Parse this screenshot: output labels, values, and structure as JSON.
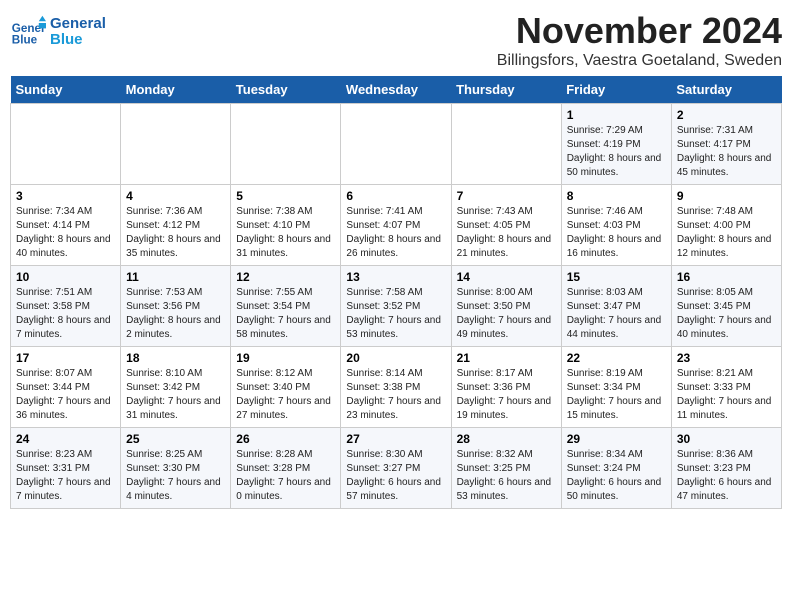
{
  "logo": {
    "text_general": "General",
    "text_blue": "Blue"
  },
  "title": "November 2024",
  "subtitle": "Billingsfors, Vaestra Goetaland, Sweden",
  "weekdays": [
    "Sunday",
    "Monday",
    "Tuesday",
    "Wednesday",
    "Thursday",
    "Friday",
    "Saturday"
  ],
  "weeks": [
    [
      {
        "day": "",
        "detail": ""
      },
      {
        "day": "",
        "detail": ""
      },
      {
        "day": "",
        "detail": ""
      },
      {
        "day": "",
        "detail": ""
      },
      {
        "day": "",
        "detail": ""
      },
      {
        "day": "1",
        "detail": "Sunrise: 7:29 AM\nSunset: 4:19 PM\nDaylight: 8 hours\nand 50 minutes."
      },
      {
        "day": "2",
        "detail": "Sunrise: 7:31 AM\nSunset: 4:17 PM\nDaylight: 8 hours\nand 45 minutes."
      }
    ],
    [
      {
        "day": "3",
        "detail": "Sunrise: 7:34 AM\nSunset: 4:14 PM\nDaylight: 8 hours\nand 40 minutes."
      },
      {
        "day": "4",
        "detail": "Sunrise: 7:36 AM\nSunset: 4:12 PM\nDaylight: 8 hours\nand 35 minutes."
      },
      {
        "day": "5",
        "detail": "Sunrise: 7:38 AM\nSunset: 4:10 PM\nDaylight: 8 hours\nand 31 minutes."
      },
      {
        "day": "6",
        "detail": "Sunrise: 7:41 AM\nSunset: 4:07 PM\nDaylight: 8 hours\nand 26 minutes."
      },
      {
        "day": "7",
        "detail": "Sunrise: 7:43 AM\nSunset: 4:05 PM\nDaylight: 8 hours\nand 21 minutes."
      },
      {
        "day": "8",
        "detail": "Sunrise: 7:46 AM\nSunset: 4:03 PM\nDaylight: 8 hours\nand 16 minutes."
      },
      {
        "day": "9",
        "detail": "Sunrise: 7:48 AM\nSunset: 4:00 PM\nDaylight: 8 hours\nand 12 minutes."
      }
    ],
    [
      {
        "day": "10",
        "detail": "Sunrise: 7:51 AM\nSunset: 3:58 PM\nDaylight: 8 hours\nand 7 minutes."
      },
      {
        "day": "11",
        "detail": "Sunrise: 7:53 AM\nSunset: 3:56 PM\nDaylight: 8 hours\nand 2 minutes."
      },
      {
        "day": "12",
        "detail": "Sunrise: 7:55 AM\nSunset: 3:54 PM\nDaylight: 7 hours\nand 58 minutes."
      },
      {
        "day": "13",
        "detail": "Sunrise: 7:58 AM\nSunset: 3:52 PM\nDaylight: 7 hours\nand 53 minutes."
      },
      {
        "day": "14",
        "detail": "Sunrise: 8:00 AM\nSunset: 3:50 PM\nDaylight: 7 hours\nand 49 minutes."
      },
      {
        "day": "15",
        "detail": "Sunrise: 8:03 AM\nSunset: 3:47 PM\nDaylight: 7 hours\nand 44 minutes."
      },
      {
        "day": "16",
        "detail": "Sunrise: 8:05 AM\nSunset: 3:45 PM\nDaylight: 7 hours\nand 40 minutes."
      }
    ],
    [
      {
        "day": "17",
        "detail": "Sunrise: 8:07 AM\nSunset: 3:44 PM\nDaylight: 7 hours\nand 36 minutes."
      },
      {
        "day": "18",
        "detail": "Sunrise: 8:10 AM\nSunset: 3:42 PM\nDaylight: 7 hours\nand 31 minutes."
      },
      {
        "day": "19",
        "detail": "Sunrise: 8:12 AM\nSunset: 3:40 PM\nDaylight: 7 hours\nand 27 minutes."
      },
      {
        "day": "20",
        "detail": "Sunrise: 8:14 AM\nSunset: 3:38 PM\nDaylight: 7 hours\nand 23 minutes."
      },
      {
        "day": "21",
        "detail": "Sunrise: 8:17 AM\nSunset: 3:36 PM\nDaylight: 7 hours\nand 19 minutes."
      },
      {
        "day": "22",
        "detail": "Sunrise: 8:19 AM\nSunset: 3:34 PM\nDaylight: 7 hours\nand 15 minutes."
      },
      {
        "day": "23",
        "detail": "Sunrise: 8:21 AM\nSunset: 3:33 PM\nDaylight: 7 hours\nand 11 minutes."
      }
    ],
    [
      {
        "day": "24",
        "detail": "Sunrise: 8:23 AM\nSunset: 3:31 PM\nDaylight: 7 hours\nand 7 minutes."
      },
      {
        "day": "25",
        "detail": "Sunrise: 8:25 AM\nSunset: 3:30 PM\nDaylight: 7 hours\nand 4 minutes."
      },
      {
        "day": "26",
        "detail": "Sunrise: 8:28 AM\nSunset: 3:28 PM\nDaylight: 7 hours\nand 0 minutes."
      },
      {
        "day": "27",
        "detail": "Sunrise: 8:30 AM\nSunset: 3:27 PM\nDaylight: 6 hours\nand 57 minutes."
      },
      {
        "day": "28",
        "detail": "Sunrise: 8:32 AM\nSunset: 3:25 PM\nDaylight: 6 hours\nand 53 minutes."
      },
      {
        "day": "29",
        "detail": "Sunrise: 8:34 AM\nSunset: 3:24 PM\nDaylight: 6 hours\nand 50 minutes."
      },
      {
        "day": "30",
        "detail": "Sunrise: 8:36 AM\nSunset: 3:23 PM\nDaylight: 6 hours\nand 47 minutes."
      }
    ]
  ]
}
